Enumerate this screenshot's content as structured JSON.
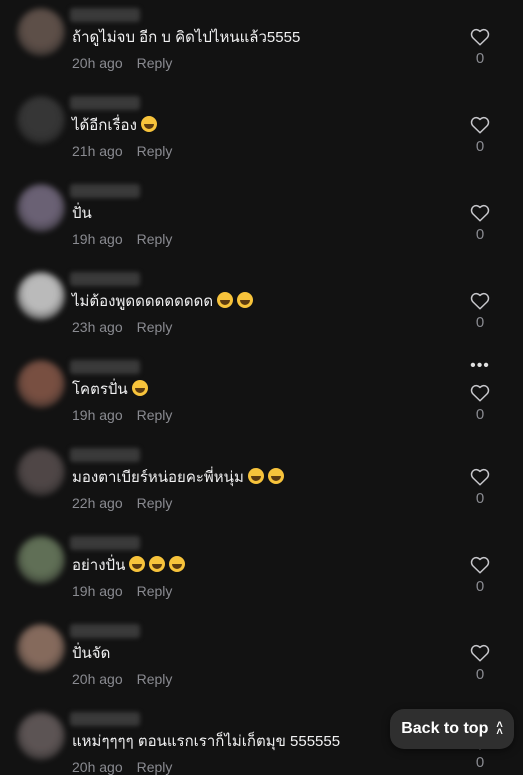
{
  "comments": [
    {
      "text": "ถ้าดูไม่จบ อีก บ คิดไปไหนแล้ว5555",
      "emojis": 0,
      "time": "20h ago",
      "reply": "Reply",
      "likes": "0",
      "avatar_color": "#6b5a52"
    },
    {
      "text": "ได้อีกเรื่อง",
      "emojis": 1,
      "time": "21h ago",
      "reply": "Reply",
      "likes": "0",
      "avatar_color": "#3d3d3d"
    },
    {
      "text": "ปั่น",
      "emojis": 0,
      "time": "19h ago",
      "reply": "Reply",
      "likes": "0",
      "avatar_color": "#7a6f86"
    },
    {
      "text": "ไม่ต้องพูดดดดดดดดด",
      "emojis": 2,
      "time": "23h ago",
      "reply": "Reply",
      "likes": "0",
      "avatar_color": "#d8d8d8"
    },
    {
      "text": "โคตรปั่น",
      "emojis": 1,
      "time": "19h ago",
      "reply": "Reply",
      "likes": "0",
      "avatar_color": "#8a5a4a"
    },
    {
      "text": "มองตาเบียร์หน่อยคะพี่หนุ่ม",
      "emojis": 2,
      "time": "22h ago",
      "reply": "Reply",
      "likes": "0",
      "avatar_color": "#5a5050"
    },
    {
      "text": "อย่างปั่น",
      "emojis": 3,
      "time": "19h ago",
      "reply": "Reply",
      "likes": "0",
      "avatar_color": "#6e8062"
    },
    {
      "text": "ปั่นจัด",
      "emojis": 0,
      "time": "20h ago",
      "reply": "Reply",
      "likes": "0",
      "avatar_color": "#9a7a6a"
    },
    {
      "text": "แหม่ๆๆๆๆ ตอนแรกเราก็ไม่เก็ตมุข 555555",
      "emojis": 0,
      "time": "20h ago",
      "reply": "Reply",
      "likes": "0",
      "avatar_color": "#6a6060"
    }
  ],
  "more_icon": "ellipsis-icon",
  "like_icon": "heart-outline-icon",
  "back_to_top": {
    "label": "Back to top",
    "icon": "double-chevron-up-icon"
  }
}
